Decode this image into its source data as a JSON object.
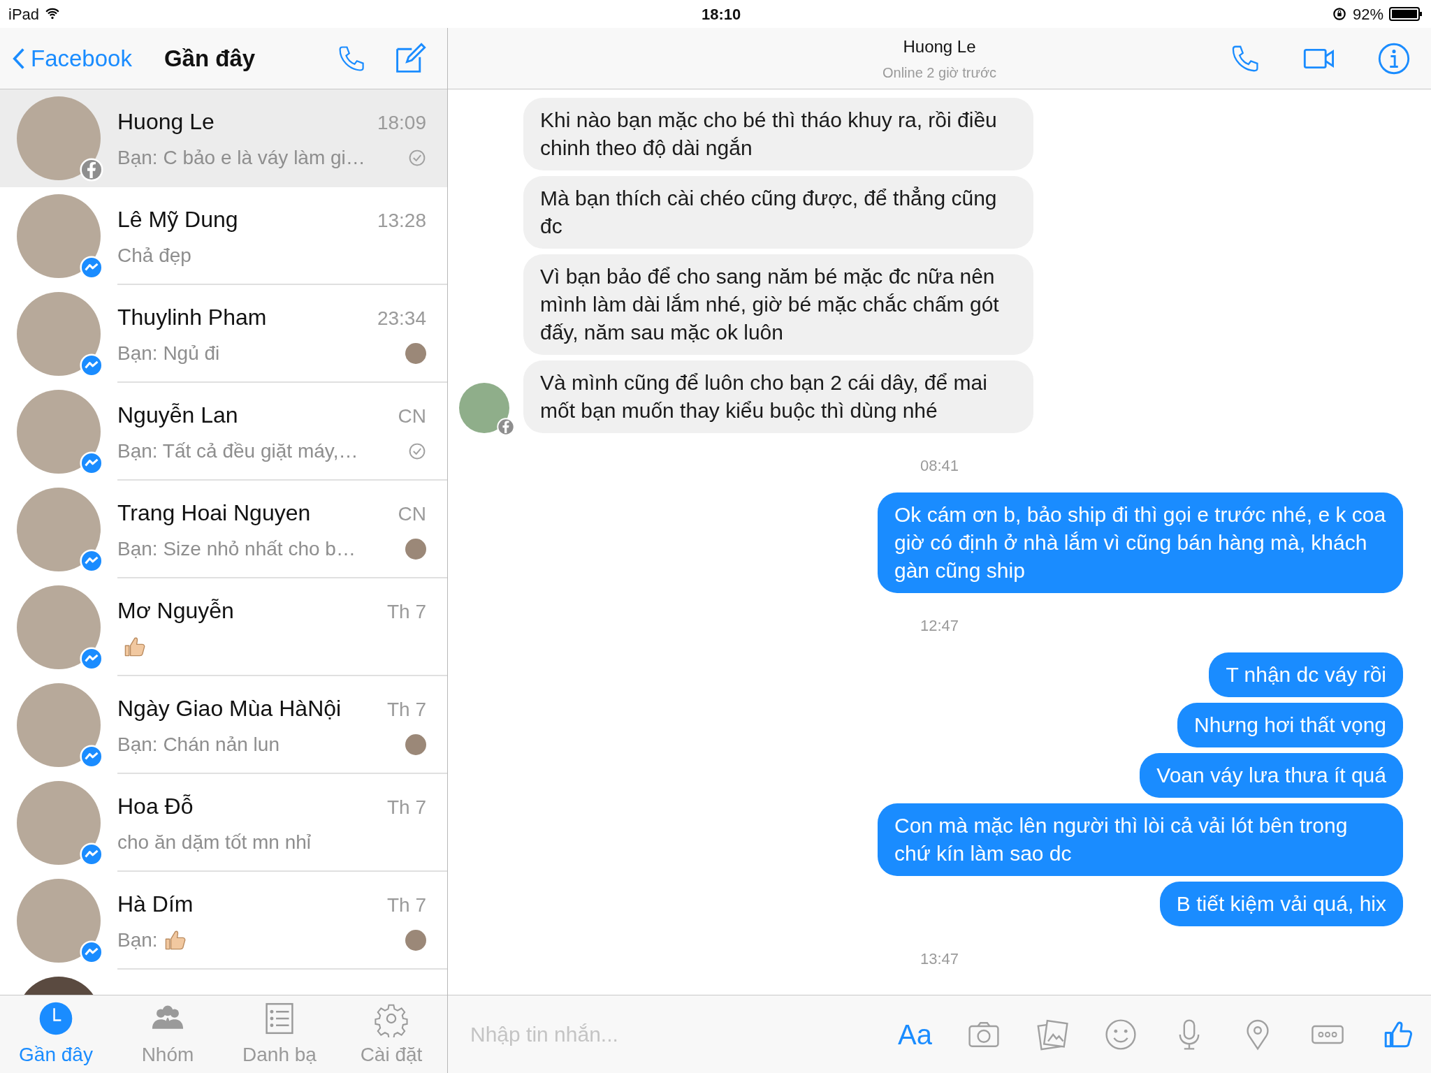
{
  "status_bar": {
    "device": "iPad",
    "time": "18:10",
    "battery": "92%"
  },
  "left_header": {
    "back": "Facebook",
    "title": "Gần đây"
  },
  "conversations": [
    {
      "name": "Huong Le",
      "time": "18:09",
      "preview": "Bạn: C bảo e là váy làm gi…",
      "sticker": false,
      "facebook_badge": true,
      "seen_check": true,
      "seen_avatar": false,
      "selected": true
    },
    {
      "name": "Lê Mỹ Dung",
      "time": "13:28",
      "preview": "Chả đẹp",
      "sticker": false,
      "facebook_badge": false,
      "seen_check": false,
      "seen_avatar": false,
      "selected": false
    },
    {
      "name": "Thuylinh Pham",
      "time": "23:34",
      "preview": "Bạn: Ngủ đi",
      "sticker": false,
      "facebook_badge": false,
      "seen_check": false,
      "seen_avatar": true,
      "selected": false
    },
    {
      "name": "Nguyễn Lan",
      "time": "CN",
      "preview": "Bạn: Tất cả đều giặt máy,…",
      "sticker": false,
      "facebook_badge": false,
      "seen_check": true,
      "seen_avatar": false,
      "selected": false
    },
    {
      "name": "Trang Hoai Nguyen",
      "time": "CN",
      "preview": "Bạn: Size nhỏ nhất cho b…",
      "sticker": false,
      "facebook_badge": false,
      "seen_check": false,
      "seen_avatar": true,
      "selected": false
    },
    {
      "name": "Mơ Nguyễn",
      "time": "Th 7",
      "sticker": true,
      "facebook_badge": false,
      "seen_check": false,
      "seen_avatar": false,
      "selected": false
    },
    {
      "name": "Ngày Giao Mùa HàNội",
      "time": "Th 7",
      "preview": "Bạn: Chán nản lun",
      "sticker": false,
      "facebook_badge": false,
      "seen_check": false,
      "seen_avatar": true,
      "selected": false
    },
    {
      "name": "Hoa Đỗ",
      "time": "Th 7",
      "preview": "cho ăn dặm tốt mn nhỉ",
      "sticker": false,
      "facebook_badge": false,
      "seen_check": false,
      "seen_avatar": false,
      "selected": false
    },
    {
      "name": "Hà Dím",
      "time": "Th 7",
      "preview": "Bạn:",
      "sticker": true,
      "facebook_badge": false,
      "seen_check": false,
      "seen_avatar": true,
      "selected": false
    }
  ],
  "list_more_below": true,
  "tabs": [
    {
      "label": "Gần đây",
      "selected": true
    },
    {
      "label": "Nhóm",
      "selected": false
    },
    {
      "label": "Danh bạ",
      "selected": false
    },
    {
      "label": "Cài đặt",
      "selected": false
    }
  ],
  "chat_header": {
    "name": "Huong Le",
    "subtitle": "Online 2 giờ trước"
  },
  "messages": [
    {
      "kind": "received",
      "text": "Khi nào bạn mặc cho bé thì tháo khuy ra, rồi điều chinh theo độ dài ngắn",
      "show_avatar": false
    },
    {
      "kind": "received",
      "text": "Mà bạn thích cài chéo cũng được, để thẳng cũng đc",
      "show_avatar": false
    },
    {
      "kind": "received",
      "text": "Vì bạn bảo để cho sang năm bé mặc đc nữa nên mình làm dài lắm nhé, giờ bé mặc chắc chấm gót đấy, năm sau mặc ok luôn",
      "show_avatar": false
    },
    {
      "kind": "received",
      "text": "Và mình cũng để luôn cho bạn 2 cái dây, để mai mốt bạn muốn thay kiểu buộc thì dùng nhé",
      "show_avatar": true
    },
    {
      "kind": "time",
      "text": "08:41"
    },
    {
      "kind": "sent",
      "text": "Ok cám ơn b, bảo ship đi thì gọi e trước nhé, e k coa giờ có định ở nhà lắm vì cũng bán hàng mà, khách gàn cũng ship"
    },
    {
      "kind": "time",
      "text": "12:47"
    },
    {
      "kind": "sent",
      "text": "T nhận dc váy rồi"
    },
    {
      "kind": "sent",
      "text": "Nhưng hơi thất vọng"
    },
    {
      "kind": "sent",
      "text": "Voan váy lưa thưa ít quá"
    },
    {
      "kind": "sent",
      "text": "Con mà mặc lên người thì lòi cả vải lót bên trong chứ kín làm sao dc"
    },
    {
      "kind": "sent",
      "text": "B tiết kiệm vải quá, hix"
    },
    {
      "kind": "time",
      "text": "13:47"
    }
  ],
  "composer": {
    "placeholder": "Nhập tin nhắn...",
    "text_button": "Aa"
  }
}
